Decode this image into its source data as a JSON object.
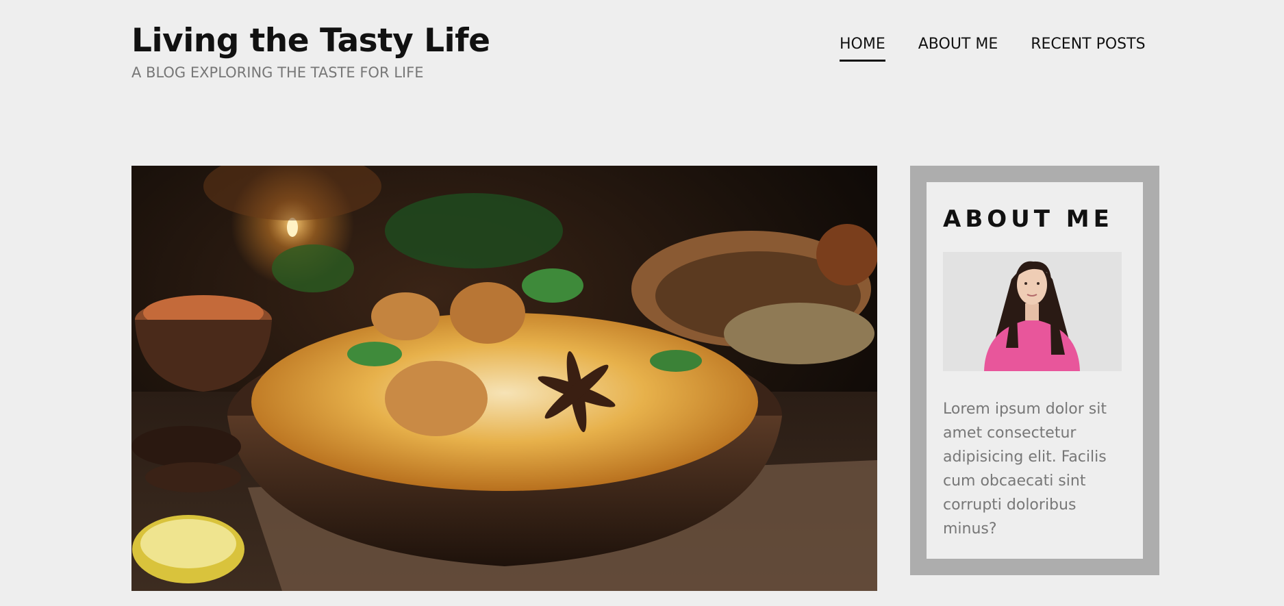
{
  "header": {
    "site_title": "Living the Tasty Life",
    "tagline": "A BLOG EXPLORING THE TASTE FOR LIFE"
  },
  "nav": {
    "items": [
      {
        "label": "HOME",
        "active": true
      },
      {
        "label": "ABOUT ME",
        "active": false
      },
      {
        "label": "RECENT POSTS",
        "active": false
      }
    ]
  },
  "sidebar": {
    "about": {
      "title": "ABOUT ME",
      "text": "Lorem ipsum dolor sit amet consectetur adipisicing elit. Facilis cum obcaecati sint corrupti doloribus minus?"
    }
  },
  "colors": {
    "background": "#eeeeee",
    "sidebar_frame": "#adadad",
    "text_dark": "#111111",
    "text_muted": "#777777"
  }
}
